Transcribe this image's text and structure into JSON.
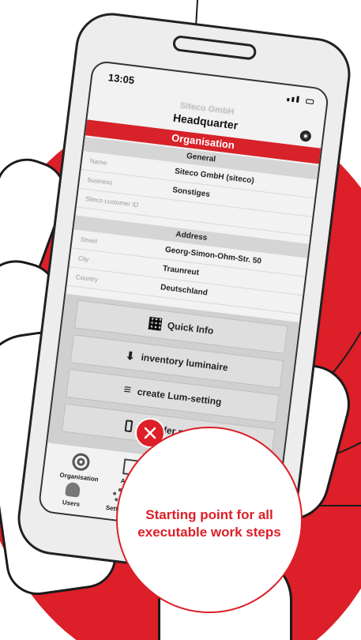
{
  "status": {
    "time": "13:05"
  },
  "header": {
    "company": "Siteco GmbH",
    "title": "Headquarter",
    "section_bar": "Organisation"
  },
  "general": {
    "heading": "General",
    "rows": [
      {
        "label": "Name",
        "value": "Siteco GmbH (siteco)"
      },
      {
        "label": "business",
        "value": "Sonstiges"
      },
      {
        "label": "Siteco customer ID",
        "value": ""
      }
    ]
  },
  "address": {
    "heading": "Address",
    "rows": [
      {
        "label": "Street",
        "value": "Georg-Simon-Ohm-Str. 50"
      },
      {
        "label": "City",
        "value": "Traunreut"
      },
      {
        "label": "Country",
        "value": "Deutschland"
      }
    ]
  },
  "quick_actions": [
    {
      "label": "Quick Info",
      "icon": "qr-code-icon"
    },
    {
      "label": "inventory luminaire",
      "icon": "luminaire-download-icon"
    },
    {
      "label": "create Lum-setting",
      "icon": "settings-lines-icon"
    },
    {
      "label": "Transfer parafile",
      "icon": "device-transfer-icon"
    }
  ],
  "tabs": [
    {
      "label": "Organisation",
      "icon": "target-icon"
    },
    {
      "label": "Areas",
      "icon": "areas-frame-icon"
    },
    {
      "label": "Users",
      "icon": "user-icon"
    },
    {
      "label": "Settings",
      "icon": "gear-icon"
    }
  ],
  "callout": {
    "text": "Starting point for all executable work steps"
  },
  "colors": {
    "brand_red": "#dc1f28",
    "outline": "#1a1a1a",
    "screen_bg": "#f2f2f2"
  }
}
